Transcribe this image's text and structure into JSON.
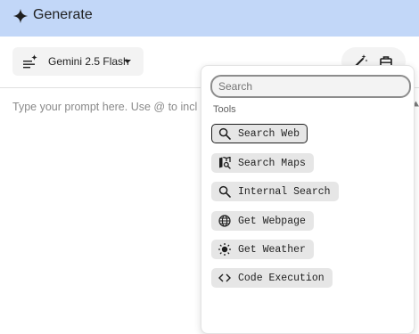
{
  "header": {
    "title": "Generate",
    "icon": "sparkle-icon"
  },
  "toolbar": {
    "model_label": "Gemini 2.5 Flash"
  },
  "prompt": {
    "placeholder": "Type your prompt here. Use @ to incl"
  },
  "tools_menu": {
    "search_placeholder": "Search",
    "section_label": "Tools",
    "items": [
      {
        "label": "Search Web",
        "icon": "search-icon",
        "selected": true
      },
      {
        "label": "Search Maps",
        "icon": "map-search-icon",
        "selected": false
      },
      {
        "label": "Internal Search",
        "icon": "search-icon",
        "selected": false
      },
      {
        "label": "Get Webpage",
        "icon": "globe-icon",
        "selected": false
      },
      {
        "label": "Get Weather",
        "icon": "sun-icon",
        "selected": false
      },
      {
        "label": "Code Execution",
        "icon": "code-icon",
        "selected": false
      }
    ]
  },
  "colors": {
    "header_bg": "#c2d7f8",
    "chip_bg": "#e6e6e6"
  }
}
